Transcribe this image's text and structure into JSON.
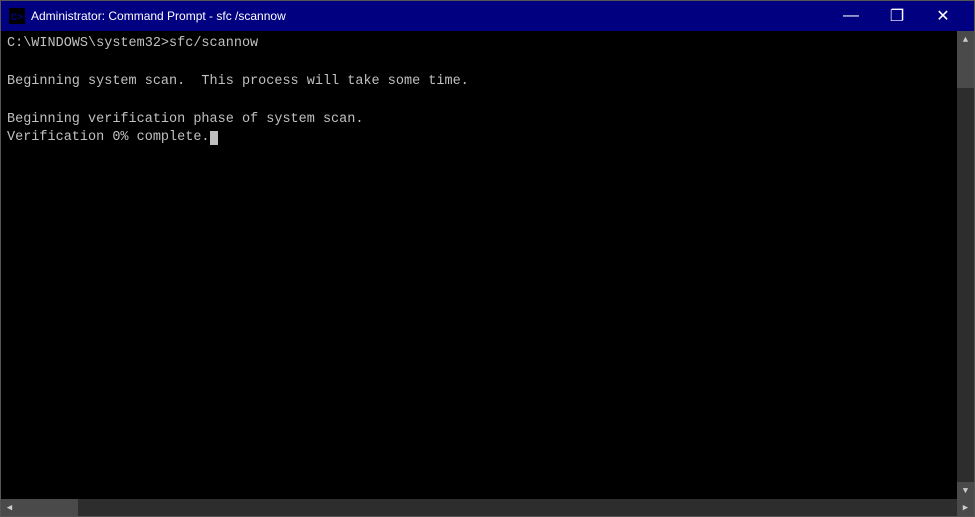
{
  "window": {
    "title": "Administrator: Command Prompt - sfc /scannow",
    "icon": "cmd-icon"
  },
  "controls": {
    "minimize": "—",
    "maximize": "❐",
    "close": "✕"
  },
  "console": {
    "lines": [
      {
        "text": "C:\\WINDOWS\\system32>sfc/scannow",
        "type": "prompt"
      },
      {
        "text": "",
        "type": "blank"
      },
      {
        "text": "Beginning system scan.  This process will take some time.",
        "type": "output"
      },
      {
        "text": "",
        "type": "blank"
      },
      {
        "text": "Beginning verification phase of system scan.",
        "type": "output"
      },
      {
        "text": "Verification 0% complete.",
        "type": "output",
        "cursor": true
      }
    ]
  }
}
